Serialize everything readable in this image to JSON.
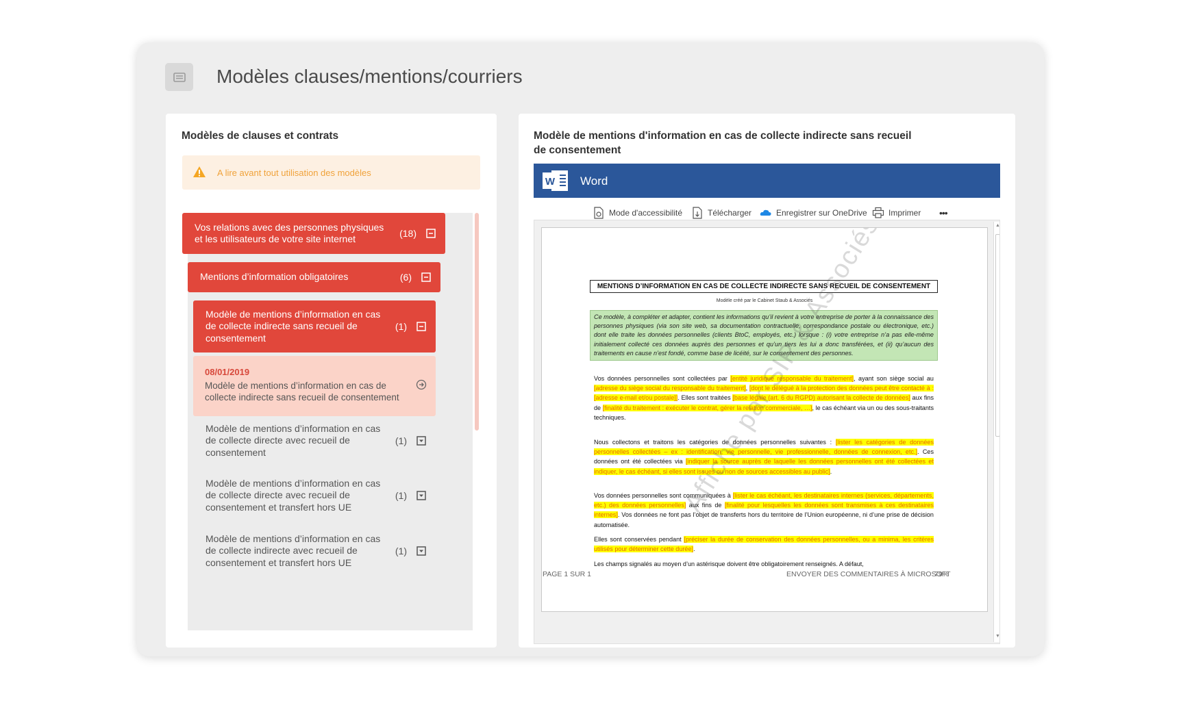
{
  "header": {
    "title": "Modèles clauses/mentions/courriers",
    "icon": "list-icon"
  },
  "left_panel": {
    "title": "Modèles de clauses et contrats",
    "warning": "A lire avant tout utilisation des modèles",
    "tree": [
      {
        "label": "Vos relations avec des personnes physiques et les utilisateurs de votre site internet",
        "count": "(18)",
        "state": "expanded"
      },
      {
        "label": "Mentions d’information obligatoires",
        "count": "(6)",
        "state": "expanded"
      },
      {
        "label": "Modèle de mentions d’information en cas de collecte indirecte sans recueil de consentement",
        "count": "(1)",
        "state": "expanded"
      },
      {
        "label": "Modèle de mentions d’information en cas de collecte directe avec recueil de consentement",
        "count": "(1)",
        "state": "collapsed"
      },
      {
        "label": "Modèle de mentions d’information en cas de collecte directe avec recueil de consentement et transfert hors UE",
        "count": "(1)",
        "state": "collapsed"
      },
      {
        "label": "Modèle de mentions d’information en cas de collecte indirecte avec recueil de consentement et transfert hors UE",
        "count": "(1)",
        "state": "collapsed"
      }
    ],
    "doc": {
      "date": "08/01/2019",
      "title": "Modèle de mentions d’information en cas de collecte indirecte sans recueil de consentement"
    }
  },
  "right_panel": {
    "title": "Modèle de mentions d'information en cas de collecte indirecte sans recueil de consentement",
    "app": "Word",
    "toolbar": [
      {
        "label": "Mode d'accessibilité",
        "icon": "accessibility-icon"
      },
      {
        "label": "Télécharger",
        "icon": "download-icon"
      },
      {
        "label": "Enregistrer sur OneDrive",
        "icon": "onedrive-icon"
      },
      {
        "label": "Imprimer",
        "icon": "print-icon"
      }
    ],
    "more": "•••",
    "document": {
      "title": "MENTIONS D’INFORMATION EN CAS DE COLLECTE INDIRECTE SANS RECUEIL DE CONSENTEMENT",
      "subtitle": "Modèle créé par le Cabinet Staub & Associés",
      "intro": "Ce modèle, à compléter et adapter, contient les informations qu’il revient à votre entreprise de porter à la connaissance des personnes physiques (via son site web, sa documentation contractuelle, correspondance postale ou électronique, etc.) dont elle traite les données personnelles (clients BtoC, employés, etc.) lorsque : (i) votre entreprise n’a pas elle-même initialement collecté ces données auprès des personnes et qu’un tiers les lui a donc transférées, et (ii) qu’aucun des traitements en cause n’est fondé, comme base de licéité, sur le consentement des personnes.",
      "p1": [
        {
          "t": "Vos données personnelles sont collectées par "
        },
        {
          "t": "[entité juridique responsable du traitement]",
          "h": true
        },
        {
          "t": ", ayant son siège social au "
        },
        {
          "t": "[adresse du siège social du responsable du traitement]",
          "h": true
        },
        {
          "t": ", "
        },
        {
          "t": "[dont le délégué à la protection des données peut être contacté à : [adresse e-mail et/ou postale]]",
          "h": true
        },
        {
          "t": ". Elles sont traitées "
        },
        {
          "t": "[base légale (art. 6 du RGPD) autorisant la collecte de données]",
          "h": true
        },
        {
          "t": " aux fins de "
        },
        {
          "t": "[finalité du traitement : exécuter le contrat, gérer la relation commerciale, …]",
          "h": true
        },
        {
          "t": ", le cas échéant via un ou des sous-traitants techniques."
        }
      ],
      "p2": [
        {
          "t": "Nous collectons et traitons les catégories de données personnelles suivantes : "
        },
        {
          "t": "[lister les catégories de données personnelles collectées – ex : identification, vie personnelle, vie professionnelle, données de connexion, etc.]",
          "h": true
        },
        {
          "t": ". Ces données ont été collectées via "
        },
        {
          "t": "[indiquer la source auprès de laquelle les données personnelles ont été collectées et indiquer, le cas échéant, si elles sont issues ou non de sources accessibles au public]",
          "h": true
        },
        {
          "t": "."
        }
      ],
      "p3": [
        {
          "t": "Vos données personnelles sont communiquées à "
        },
        {
          "t": "[lister le cas échéant, les destinataires internes (services, départements, etc.) des données personnelles]",
          "h": true
        },
        {
          "t": " aux fins de "
        },
        {
          "t": "[finalité pour lesquelles les données sont transmises à ces destinataires internes]",
          "h": true
        },
        {
          "t": ". Vos données ne font pas l’objet de transferts hors du territoire de l’Union européenne, ni d’une prise de décision automatisée."
        }
      ],
      "p4": [
        {
          "t": "Elles sont conservées pendant "
        },
        {
          "t": "[préciser la durée de conservation des données personnelles, ou a minima, les critères utilisés pour déterminer cette durée]",
          "h": true
        },
        {
          "t": "."
        }
      ],
      "p5": [
        {
          "t": "Les champs signalés au moyen d’un astérisque doivent être obligatoirement renseignés. A défaut,"
        }
      ],
      "watermark": "Affiche par SIP & Associés"
    },
    "status": {
      "page": "PAGE 1 SUR 1",
      "feedback": "ENVOYER DES COMMENTAIRES À MICROSOFT",
      "zoom": "79%"
    }
  }
}
